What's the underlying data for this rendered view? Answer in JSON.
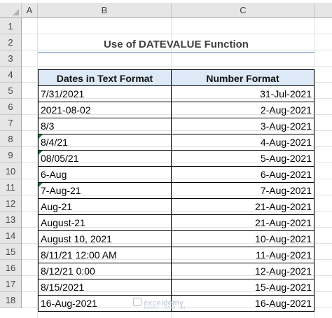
{
  "columns": [
    "A",
    "B",
    "C"
  ],
  "rows": [
    "1",
    "2",
    "3",
    "4",
    "5",
    "6",
    "7",
    "8",
    "9",
    "10",
    "11",
    "12",
    "13",
    "14",
    "15",
    "16",
    "17",
    "18"
  ],
  "title": "Use of DATEVALUE Function",
  "table": {
    "headers": [
      "Dates in Text Format",
      "Number Format"
    ],
    "records": [
      {
        "text": "7/31/2021",
        "number": "31-Jul-2021",
        "flag": false
      },
      {
        "text": "2021-08-02",
        "number": "2-Aug-2021",
        "flag": false
      },
      {
        "text": "8/3",
        "number": "3-Aug-2021",
        "flag": false
      },
      {
        "text": "8/4/21",
        "number": "4-Aug-2021",
        "flag": true
      },
      {
        "text": "08/05/21",
        "number": "5-Aug-2021",
        "flag": true
      },
      {
        "text": "6-Aug",
        "number": "6-Aug-2021",
        "flag": false
      },
      {
        "text": "7-Aug-21",
        "number": "7-Aug-2021",
        "flag": true
      },
      {
        "text": "Aug-21",
        "number": "21-Aug-2021",
        "flag": false
      },
      {
        "text": "August-21",
        "number": "21-Aug-2021",
        "flag": false
      },
      {
        "text": "August 10, 2021",
        "number": "10-Aug-2021",
        "flag": false
      },
      {
        "text": "8/11/21 12:00 AM",
        "number": "11-Aug-2021",
        "flag": false
      },
      {
        "text": "8/12/21 0:00",
        "number": "12-Aug-2021",
        "flag": false
      },
      {
        "text": "8/15/2021",
        "number": "15-Aug-2021",
        "flag": false
      },
      {
        "text": "16-Aug-2021",
        "number": "16-Aug-2021",
        "flag": false
      }
    ]
  },
  "watermark": {
    "name": "exceldemy",
    "tagline": "EXCEL · DATA · BI"
  },
  "colors": {
    "header_fill": "#dde9f6",
    "title_underline": "#a9bde0",
    "error_flag": "#1e7b34"
  }
}
